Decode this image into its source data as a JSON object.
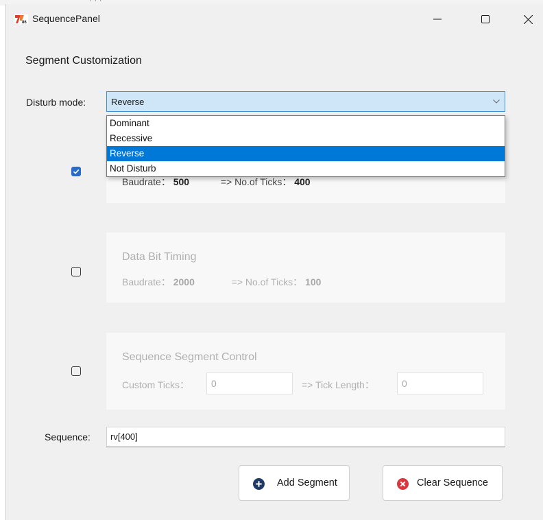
{
  "window": {
    "title": "SequencePanel"
  },
  "section_title": "Segment Customization",
  "disturb": {
    "label": "Disturb mode:",
    "selected": "Reverse",
    "options": [
      "Dominant",
      "Recessive",
      "Reverse",
      "Not Disturb"
    ]
  },
  "cards": [
    {
      "checked": true,
      "title": "",
      "baudrate_label": "Baudrate：",
      "baudrate_value": "500",
      "ticks_label": "=> No.of Ticks：",
      "ticks_value": "400"
    },
    {
      "checked": false,
      "title": "Data Bit Timing",
      "baudrate_label": "Baudrate：",
      "baudrate_value": "2000",
      "ticks_label": "=> No.of Ticks：",
      "ticks_value": "100"
    },
    {
      "checked": false,
      "title": "Sequence Segment Control",
      "custom_ticks_label": "Custom Ticks：",
      "custom_ticks_value": "0",
      "tick_length_label": "=> Tick Length：",
      "tick_length_value": "0"
    }
  ],
  "sequence": {
    "label": "Sequence:",
    "value": "rv[400]"
  },
  "buttons": {
    "add": "Add Segment",
    "clear": "Clear Sequence"
  },
  "colors": {
    "accent": "#0078d7",
    "checkbox": "#2a6ac8",
    "add_icon": "#1f3a66",
    "clear_icon": "#d9363e"
  }
}
